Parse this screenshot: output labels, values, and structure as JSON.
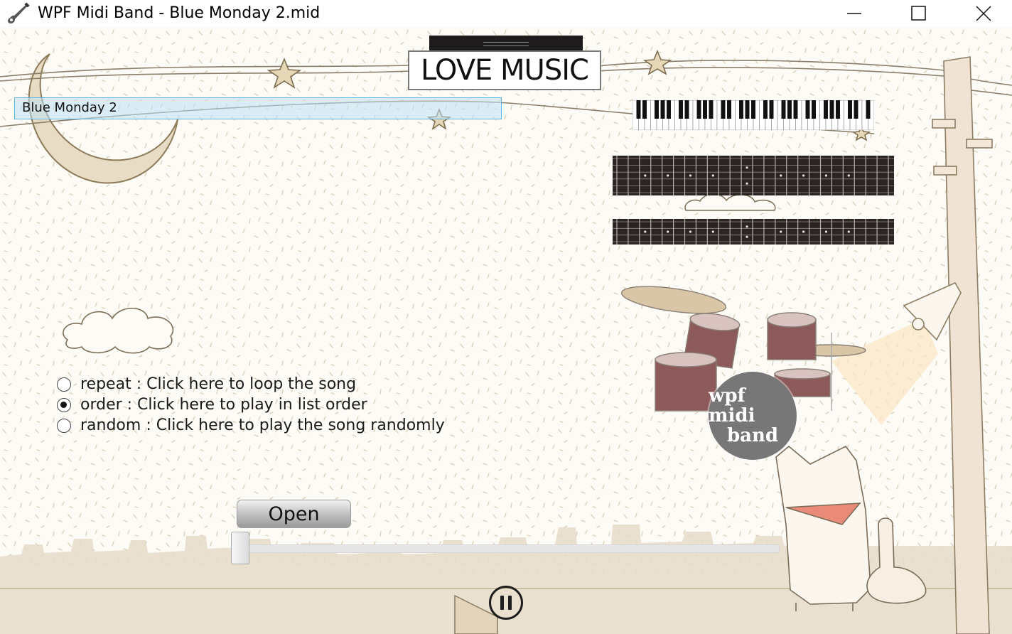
{
  "window": {
    "title": "WPF Midi Band - Blue Monday 2.mid",
    "app_icon": "guitar-icon",
    "controls": [
      "minimize-icon",
      "maximize-icon",
      "close-icon"
    ]
  },
  "sign": {
    "text": "LOVE MUSIC"
  },
  "song": {
    "current_name": "Blue Monday 2"
  },
  "play_modes": [
    {
      "label": "repeat : Click here to loop the song",
      "selected": false
    },
    {
      "label": "order : Click here to play in list order",
      "selected": true
    },
    {
      "label": "random : Click here to play the song randomly",
      "selected": false
    }
  ],
  "controls": {
    "open_label": "Open",
    "progress": 0.0,
    "pause_icon": "pause-icon"
  },
  "drum_badge": {
    "line1": "wpf midi",
    "line2": "band"
  },
  "colors": {
    "song_box_fill": "#bee1f5",
    "song_box_border": "#62b2e2",
    "sign_bar": "#1d1b1b",
    "drum_shell": "#8c5a5a"
  }
}
